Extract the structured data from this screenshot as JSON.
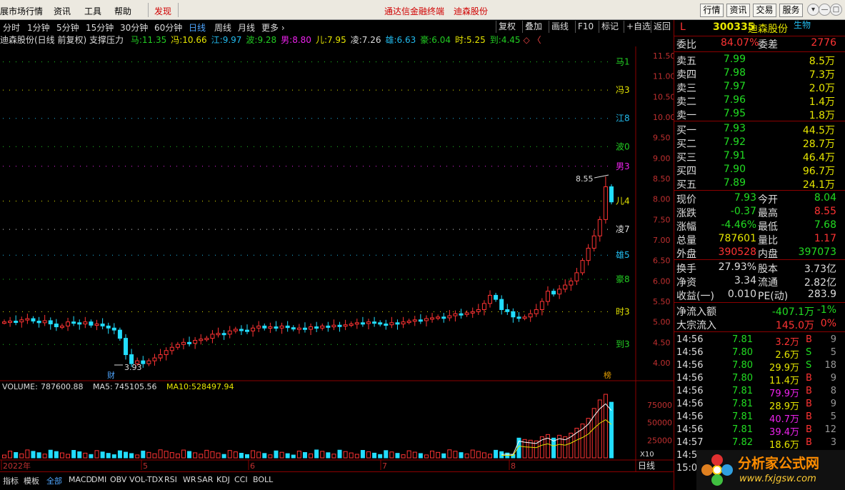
{
  "menubar": {
    "items": [
      "展市场行情",
      "资讯",
      "工具",
      "帮助"
    ],
    "found": "发现",
    "center1": "通达信金融终端",
    "center2": "迪森股份",
    "right_buttons": [
      "行情",
      "资讯",
      "交易",
      "服务"
    ],
    "controls": [
      "▾",
      "—",
      "□",
      "×"
    ]
  },
  "periods": [
    "分时",
    "1分钟",
    "5分钟",
    "15分钟",
    "30分钟",
    "60分钟",
    "日线",
    "周线",
    "月线",
    "更多 ›"
  ],
  "active_period": "日线",
  "toolbar": [
    "复权",
    "叠加",
    "画线",
    "F10",
    "标记",
    "+自选",
    "返回"
  ],
  "info": {
    "title": "迪森股份(日线 前复权) 支撑压力",
    "lines": [
      {
        "name": "马:",
        "val": "11.35",
        "color": "#22cc22"
      },
      {
        "name": "冯:",
        "val": "10.66",
        "color": "#e6e600"
      },
      {
        "name": "江:",
        "val": "9.97",
        "color": "#22bbee"
      },
      {
        "name": "波:",
        "val": "9.28",
        "color": "#22cc22"
      },
      {
        "name": "男:",
        "val": "8.80",
        "color": "#ee22ee"
      },
      {
        "name": "儿:",
        "val": "7.95",
        "color": "#e6e600"
      },
      {
        "name": "凌:",
        "val": "7.26",
        "color": "#dddddd"
      },
      {
        "name": "雄:",
        "val": "6.63",
        "color": "#22bbee"
      },
      {
        "name": "豪:",
        "val": "6.04",
        "color": "#22cc22"
      },
      {
        "name": "时:",
        "val": "5.25",
        "color": "#e6e600"
      },
      {
        "name": "到:",
        "val": "4.45",
        "color": "#22cc22"
      }
    ],
    "tail": "◇ 〈"
  },
  "chart_data": {
    "type": "candlestick",
    "dates_marks": [
      "2022年",
      "5",
      "6",
      "7",
      "8"
    ],
    "price_axis": [
      "11.50",
      "11.00",
      "10.50",
      "10.00",
      "9.50",
      "9.00",
      "8.50",
      "8.00",
      "7.50",
      "7.00",
      "6.50",
      "6.00",
      "5.50",
      "5.00",
      "4.50",
      "4.00"
    ],
    "levels": [
      {
        "label": "马1",
        "value": 11.35,
        "color": "#22cc22"
      },
      {
        "label": "冯3",
        "value": 10.66,
        "color": "#e6e600"
      },
      {
        "label": "江8",
        "value": 9.97,
        "color": "#22bbee"
      },
      {
        "label": "波0",
        "value": 9.28,
        "color": "#22cc22"
      },
      {
        "label": "男3",
        "value": 8.8,
        "color": "#ee22ee"
      },
      {
        "label": "儿4",
        "value": 7.95,
        "color": "#e6e600"
      },
      {
        "label": "凌7",
        "value": 7.26,
        "color": "#dddddd"
      },
      {
        "label": "雄5",
        "value": 6.63,
        "color": "#22bbee"
      },
      {
        "label": "豪8",
        "value": 6.04,
        "color": "#22cc22"
      },
      {
        "label": "时3",
        "value": 5.25,
        "color": "#e6e600"
      },
      {
        "label": "到3",
        "value": 4.45,
        "color": "#22cc22"
      }
    ],
    "annot_high": "8.55",
    "annot_low": "3.93",
    "annot_cai": "财",
    "annot_bang": "榜",
    "closes": [
      5.0,
      5.02,
      5.0,
      5.05,
      5.08,
      5.02,
      4.98,
      5.03,
      4.95,
      4.88,
      4.9,
      5.0,
      4.98,
      4.95,
      5.0,
      4.92,
      4.95,
      4.9,
      4.85,
      4.8,
      4.6,
      4.2,
      3.98,
      4.05,
      3.98,
      4.05,
      4.12,
      4.2,
      4.3,
      4.38,
      4.45,
      4.5,
      4.48,
      4.55,
      4.58,
      4.6,
      4.7,
      4.72,
      4.7,
      4.78,
      4.82,
      4.8,
      4.78,
      4.85,
      4.9,
      4.85,
      4.88,
      4.85,
      4.9,
      4.86,
      4.83,
      4.85,
      4.82,
      4.88,
      4.85,
      4.9,
      4.88,
      4.92,
      4.9,
      4.93,
      4.95,
      4.98,
      4.96,
      5.0,
      4.98,
      4.95,
      4.93,
      4.98,
      4.95,
      5.0,
      5.02,
      5.05,
      5.03,
      5.08,
      5.1,
      5.12,
      5.1,
      5.15,
      5.2,
      5.18,
      5.22,
      5.25,
      5.3,
      5.45,
      5.65,
      5.55,
      5.3,
      5.25,
      5.12,
      5.1,
      5.12,
      5.2,
      5.3,
      5.5,
      5.75,
      5.68,
      5.8,
      5.9,
      6.0,
      6.2,
      6.5,
      6.8,
      7.1,
      7.5,
      8.3,
      7.93
    ],
    "volume": {
      "label": "VOLUME:",
      "value": "787600.88",
      "ma5_label": "MA5:",
      "ma5": "745105.56",
      "ma10_label": "MA10:",
      "ma10": "528497.94",
      "axis": [
        "75000",
        "50000",
        "25000"
      ],
      "unit": "X10",
      "last_bars": [
        280000,
        260000,
        250000,
        240000,
        300000,
        330000,
        280000,
        320000,
        300000,
        350000,
        420000,
        480000,
        560000,
        700000,
        820000,
        900000,
        787600
      ]
    }
  },
  "tabs": [
    "指标",
    "模板",
    "全部",
    "MACD",
    "DMI",
    "OBV",
    "VOL-TDX",
    "RSI",
    "WR",
    "SAR",
    "KDJ",
    "CCI",
    "BOLL"
  ],
  "period_label": "日线",
  "quote": {
    "flag": "L",
    "code": "300335",
    "name": "迪森股份",
    "industry": "生物",
    "wb_label": "委比",
    "wb": "84.07%",
    "wc_label": "委差",
    "wc": "2776",
    "asks": [
      {
        "l": "卖五",
        "p": "7.99",
        "v": "8.5万"
      },
      {
        "l": "卖四",
        "p": "7.98",
        "v": "7.3万"
      },
      {
        "l": "卖三",
        "p": "7.97",
        "v": "2.0万"
      },
      {
        "l": "卖二",
        "p": "7.96",
        "v": "1.4万"
      },
      {
        "l": "卖一",
        "p": "7.95",
        "v": "1.8万"
      }
    ],
    "bids": [
      {
        "l": "买一",
        "p": "7.93",
        "v": "44.5万"
      },
      {
        "l": "买二",
        "p": "7.92",
        "v": "28.7万"
      },
      {
        "l": "买三",
        "p": "7.91",
        "v": "46.4万"
      },
      {
        "l": "买四",
        "p": "7.90",
        "v": "96.7万"
      },
      {
        "l": "买五",
        "p": "7.89",
        "v": "24.1万"
      }
    ],
    "stats": [
      [
        "现价",
        "7.93",
        "#22dd22",
        "今开",
        "8.04",
        "#22dd22"
      ],
      [
        "涨跌",
        "-0.37",
        "#22dd22",
        "最高",
        "8.55",
        "#ff3333"
      ],
      [
        "涨幅",
        "-4.46%",
        "#22dd22",
        "最低",
        "7.68",
        "#22dd22"
      ],
      [
        "总量",
        "787601",
        "#e6e600",
        "量比",
        "1.17",
        "#ff3333"
      ],
      [
        "外盘",
        "390528",
        "#ff3333",
        "内盘",
        "397073",
        "#22dd22"
      ]
    ],
    "stats2": [
      [
        "换手",
        "27.93%",
        "#dddddd",
        "股本",
        "3.73亿",
        "#dddddd"
      ],
      [
        "净资",
        "3.34",
        "#dddddd",
        "流通",
        "2.82亿",
        "#dddddd"
      ],
      [
        "收益(一)",
        "0.010",
        "#dddddd",
        "PE(动)",
        "283.9",
        "#dddddd"
      ]
    ],
    "flow": [
      {
        "l": "净流入额",
        "v": "-407.1万",
        "p": "-1%"
      },
      {
        "l": "大宗流入",
        "v": "145.0万",
        "p": "0%"
      }
    ],
    "ticks": [
      [
        "14:56",
        "7.81",
        "3.2万",
        "B",
        "9",
        "#ff3333",
        "#ff3333"
      ],
      [
        "14:56",
        "7.80",
        "2.6万",
        "S",
        "5",
        "#e6e600",
        "#22dd22"
      ],
      [
        "14:56",
        "7.80",
        "29.9万",
        "S",
        "18",
        "#e6e600",
        "#22dd22"
      ],
      [
        "14:56",
        "7.80",
        "11.4万",
        "B",
        "9",
        "#e6e600",
        "#ff3333"
      ],
      [
        "14:56",
        "7.81",
        "79.9万",
        "B",
        "8",
        "#ee22ee",
        "#ff3333"
      ],
      [
        "14:56",
        "7.81",
        "28.9万",
        "B",
        "9",
        "#e6e600",
        "#ff3333"
      ],
      [
        "14:56",
        "7.81",
        "40.7万",
        "B",
        "5",
        "#ee22ee",
        "#ff3333"
      ],
      [
        "14:56",
        "7.81",
        "39.4万",
        "B",
        "12",
        "#ee22ee",
        "#ff3333"
      ],
      [
        "14:57",
        "7.82",
        "18.6万",
        "B",
        "3",
        "#e6e600",
        "#ff3333"
      ],
      [
        "14:5",
        "",
        "",
        "",
        "",
        ""
      ],
      [
        "15:0",
        "",
        "",
        "",
        "",
        ""
      ]
    ]
  },
  "watermark": {
    "title": "分析家公式网",
    "url": "www.fxjgsw.com"
  }
}
